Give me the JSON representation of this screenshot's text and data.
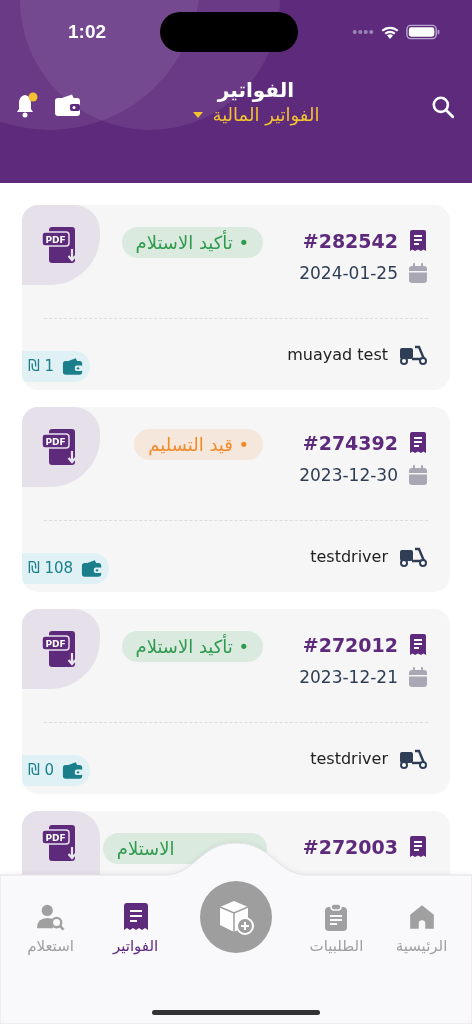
{
  "status_bar": {
    "time": "1:02"
  },
  "header": {
    "title": "الفواتير",
    "subtitle": "الفواتير المالية",
    "notification_dot": true
  },
  "invoices": [
    {
      "number": "#282542",
      "date": "2024-01-25",
      "status": {
        "text": "• تأكيد الاستلام",
        "color": "#2e9a4e"
      },
      "pdf_label": "PDF",
      "driver": "muayad test",
      "amount": "₪ 1",
      "partial": false
    },
    {
      "number": "#274392",
      "date": "2023-12-30",
      "status": {
        "text": "• قيد التسليم",
        "color": "#f08a2a"
      },
      "pdf_label": "PDF",
      "driver": "testdriver",
      "amount": "₪ 108",
      "partial": false
    },
    {
      "number": "#272012",
      "date": "2023-12-21",
      "status": {
        "text": "• تأكيد الاستلام",
        "color": "#2e9a4e"
      },
      "pdf_label": "PDF",
      "driver": "testdriver",
      "amount": "₪ 0",
      "partial": false
    },
    {
      "number": "#272003",
      "status": {
        "text": "الاستلام",
        "color": "#2e9a4e"
      },
      "pdf_label": "PDF",
      "partial": true
    }
  ],
  "tab_bar": {
    "items": [
      {
        "label": "الرئيسية",
        "selected": false
      },
      {
        "label": "الطلبيات",
        "selected": false
      },
      {
        "label": "الفواتير",
        "selected": true
      },
      {
        "label": "استعلام",
        "selected": false
      }
    ]
  }
}
